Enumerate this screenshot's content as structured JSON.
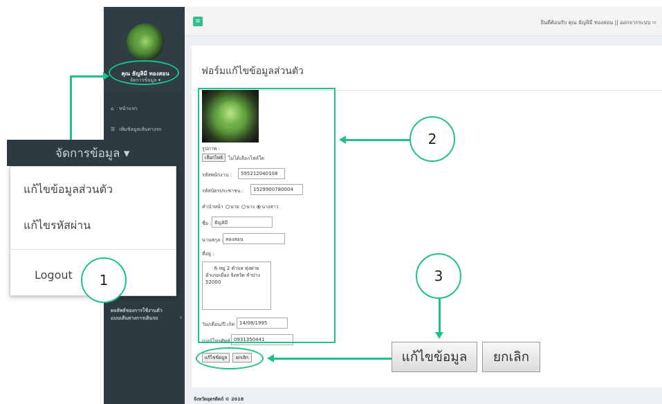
{
  "sidebar": {
    "username": "คุณ ธัญลิมี ทองสอน",
    "manage": "จัดการข้อมูล ▾",
    "items": [
      {
        "icon": "home-icon",
        "glyph": "⌂",
        "label": "หน้าแรก"
      },
      {
        "icon": "list-icon",
        "glyph": "☰",
        "label": "เพิ่มข้อมูลเส้นทางรถ"
      }
    ],
    "bottom_line1": "ผลลัพธ์ของการใช้งานตัว",
    "bottom_line2": "แบบเส้นทางการเดินรถ",
    "bottom_chevron": "‹"
  },
  "header": {
    "menu_glyph": "≡",
    "welcome": "ยินดีต้อนรับ คุณ ธัญลิมี ทองสอน || ออกจากระบบ ⇨"
  },
  "page": {
    "title": "ฟอร์มแก้ไขข้อมูลส่วนตัว",
    "footer": "จังหวัดอุตรดิตถ์ © 2018"
  },
  "form": {
    "photo_label": "รูปภาพ :",
    "file_button": "เลือกไฟล์",
    "file_status": "ไม่ได้เลือกไฟล์ใด",
    "emp_id_label": "รหัสพนักงาน :",
    "emp_id_value": "595212040108",
    "citizen_id_label": "รหัสบัตรประชาชน :",
    "citizen_id_value": "1529900780004",
    "prefix_label": "คำนำหน้า",
    "prefix_options": [
      "นาย",
      "นาง",
      "นางสาว"
    ],
    "prefix_selected": "นางสาว",
    "firstname_label": "ชื่อ :",
    "firstname_value": "ธัญลิมี",
    "lastname_label": "นามสกุล :",
    "lastname_value": "ทองสอน",
    "address_label": "ที่อยู่ :",
    "address_line1": "6 หมู่ 2 ตำบล ทุ่งฝาย",
    "address_line2": "อำเภอเมือง จังหวัด ลำปาง",
    "address_line3": "52000",
    "dob_label": "วัน/เดือน/ปี เกิด :",
    "dob_value": "14/08/1995",
    "phone_label": "เบอร์โทรศัพท์ :",
    "phone_value": "0931350441",
    "save_button": "แก้ไขข้อมูล",
    "cancel_button": "ยกเลิก"
  },
  "dropdown": {
    "head": "จัดการข้อมูล ▾",
    "items": [
      "แก้ไขข้อมูลส่วนตัว",
      "แก้ไขรหัสผ่าน",
      "Logout"
    ]
  },
  "zoom_buttons": {
    "save": "แก้ไขข้อมูล",
    "cancel": "ยกเลิก"
  },
  "annotations": [
    "1",
    "2",
    "3"
  ],
  "colors": {
    "accent": "#1fbf8e",
    "sidebar": "#2c3b41",
    "content_bg": "#ecf0f5"
  }
}
